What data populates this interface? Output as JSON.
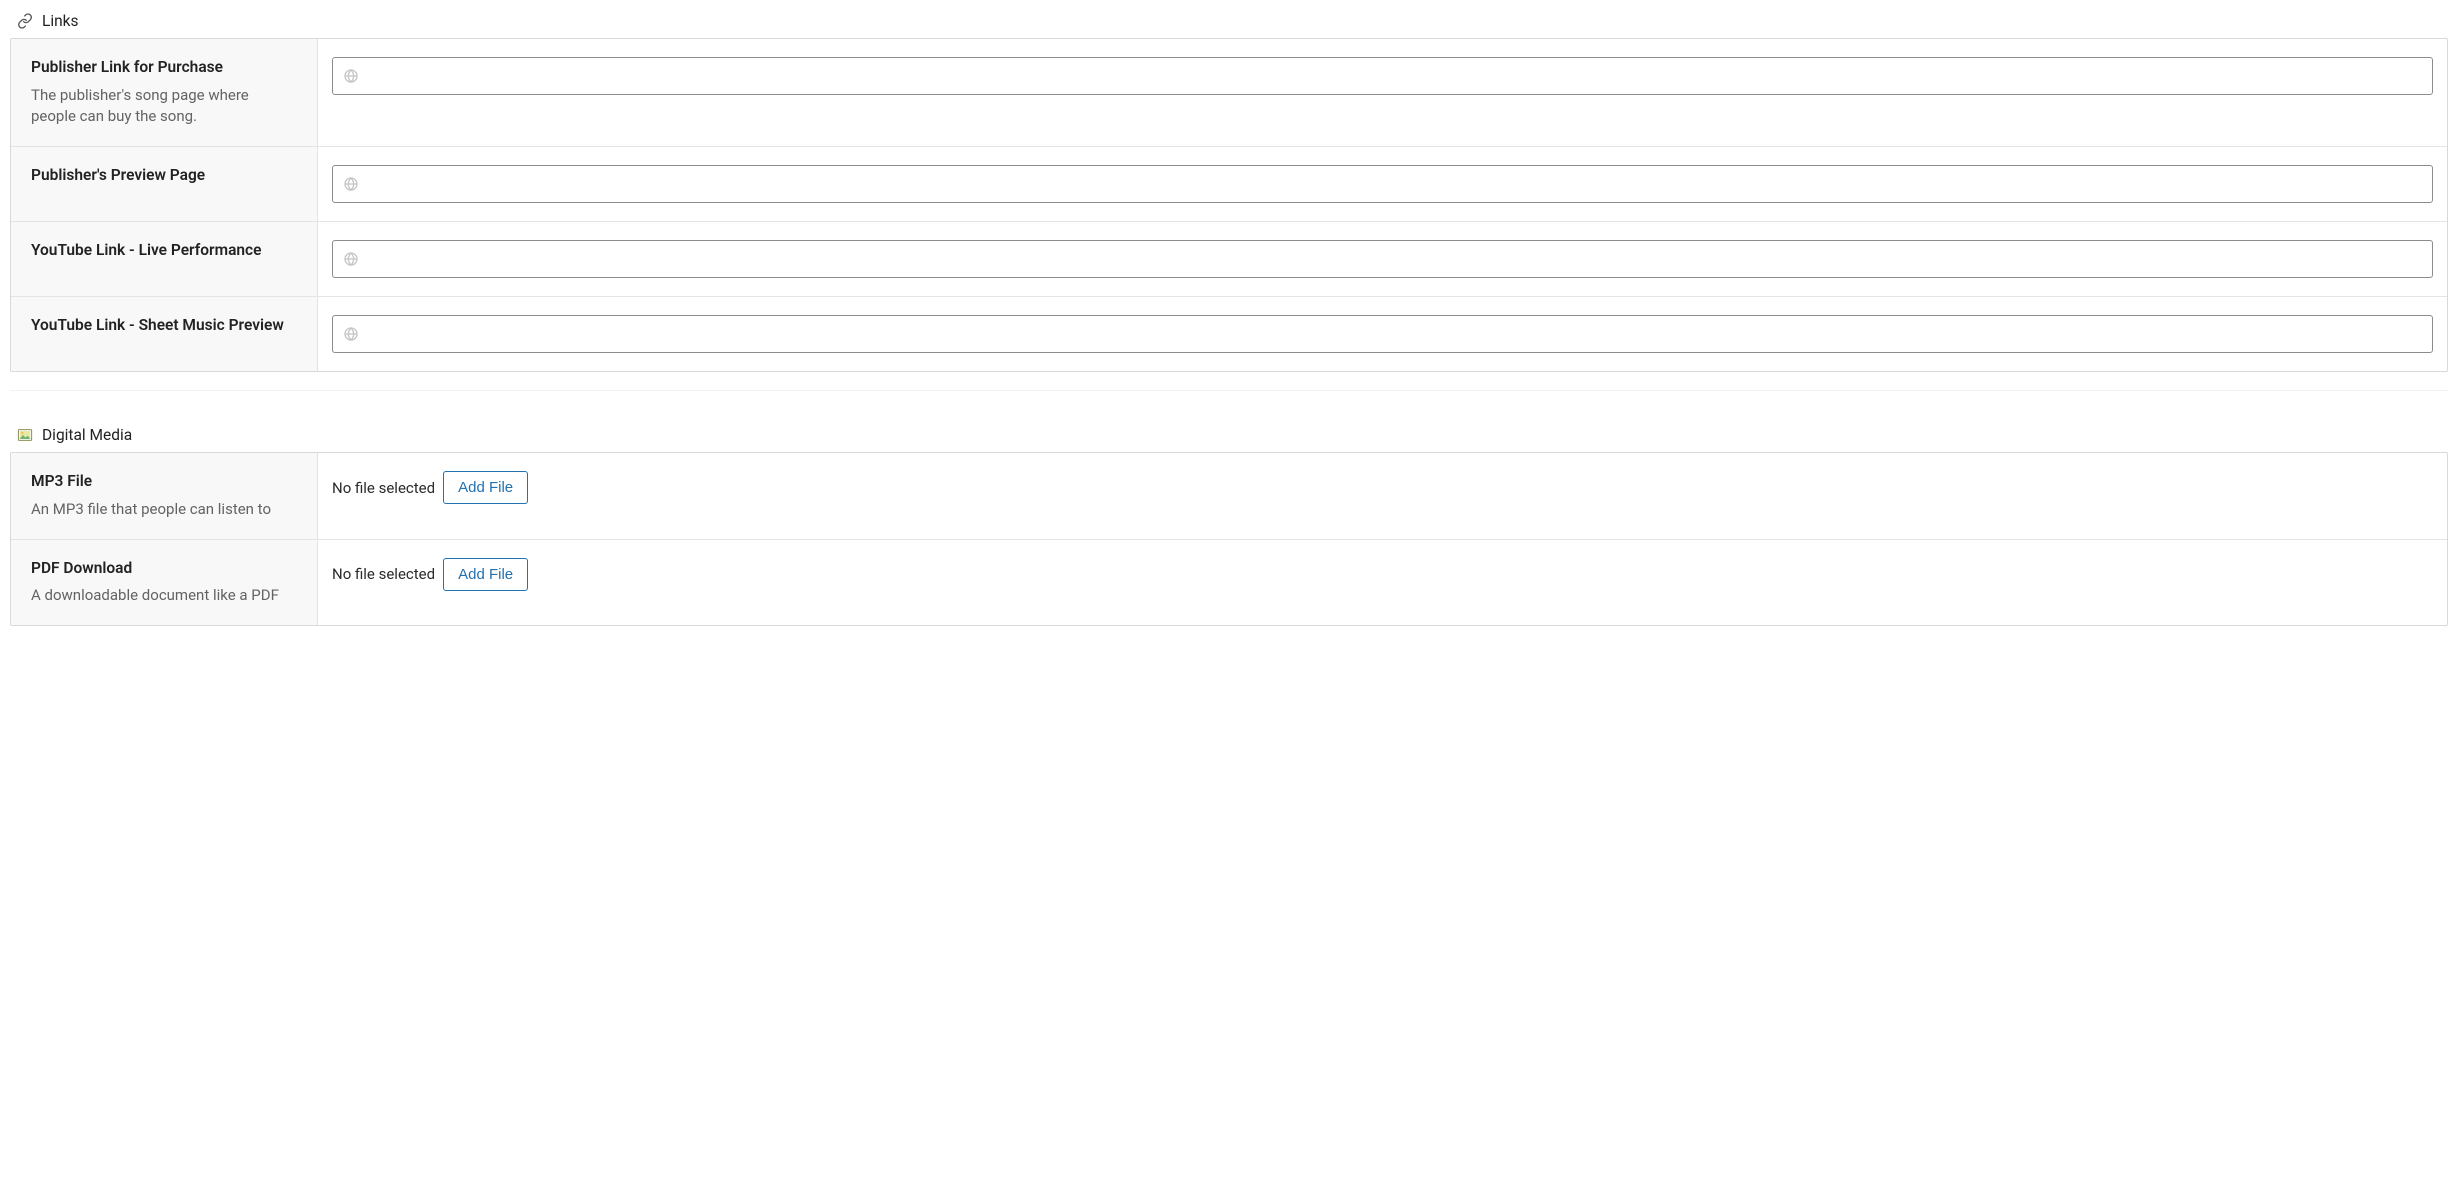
{
  "sections": {
    "links": {
      "title": "Links",
      "rows": [
        {
          "label": "Publisher Link for Purchase",
          "desc": "The publisher's song page where people can buy the song.",
          "value": ""
        },
        {
          "label": "Publisher's Preview Page",
          "desc": "",
          "value": ""
        },
        {
          "label": "YouTube Link - Live Performance",
          "desc": "",
          "value": ""
        },
        {
          "label": "YouTube Link - Sheet Music Preview",
          "desc": "",
          "value": ""
        }
      ]
    },
    "digital": {
      "title": "Digital Media",
      "rows": [
        {
          "label": "MP3 File",
          "desc": "An MP3 file that people can listen to",
          "status": "No file selected",
          "button": "Add File"
        },
        {
          "label": "PDF Download",
          "desc": "A downloadable document like a PDF",
          "status": "No file selected",
          "button": "Add File"
        }
      ]
    }
  }
}
